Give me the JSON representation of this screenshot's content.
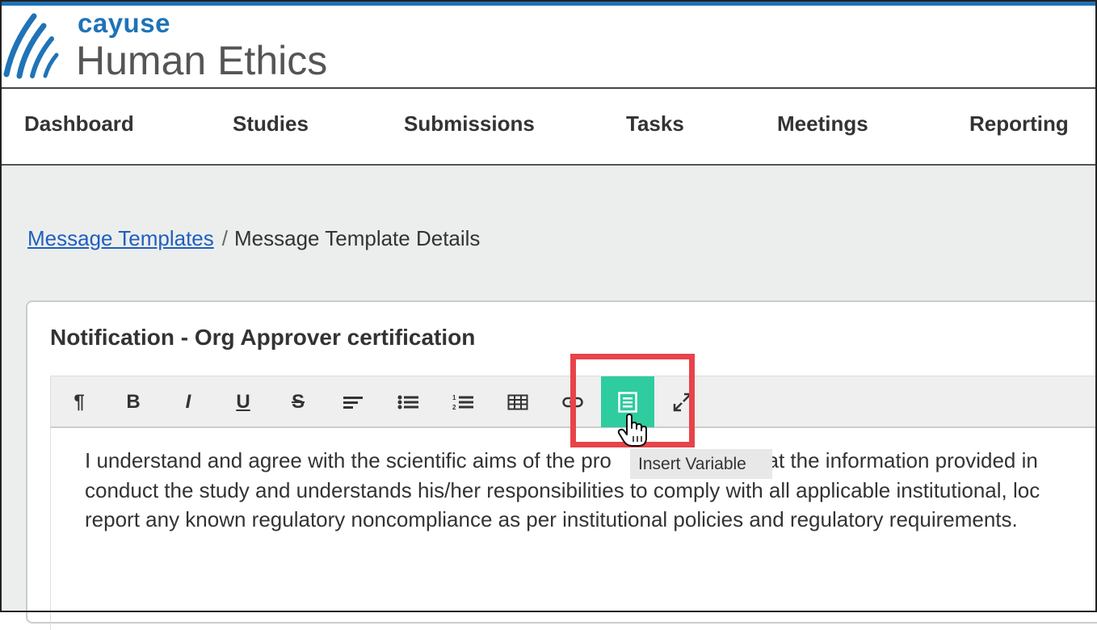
{
  "header": {
    "brand": "cayuse",
    "product": "Human Ethics",
    "colors": {
      "accent": "#1f73b7",
      "active_button": "#2ecc9f",
      "highlight": "#e8434a"
    }
  },
  "nav": {
    "items": [
      "Dashboard",
      "Studies",
      "Submissions",
      "Tasks",
      "Meetings",
      "Reporting"
    ]
  },
  "breadcrumb": {
    "link": "Message Templates",
    "separator": "/",
    "current": "Message Template Details"
  },
  "card": {
    "title": "Notification - Org Approver certification"
  },
  "toolbar": {
    "buttons": [
      {
        "icon": "paragraph-icon",
        "glyph": "¶"
      },
      {
        "icon": "bold-icon",
        "glyph": "B"
      },
      {
        "icon": "italic-icon",
        "glyph": "I"
      },
      {
        "icon": "underline-icon",
        "glyph": "U"
      },
      {
        "icon": "strikethrough-icon",
        "glyph": "S"
      },
      {
        "icon": "align-left-icon"
      },
      {
        "icon": "bullet-list-icon"
      },
      {
        "icon": "numbered-list-icon"
      },
      {
        "icon": "table-icon"
      },
      {
        "icon": "link-icon"
      },
      {
        "icon": "insert-variable-icon",
        "active": true
      },
      {
        "icon": "fullscreen-icon"
      }
    ],
    "tooltip": "Insert Variable"
  },
  "editor": {
    "lines": [
      "I understand and agree with the scientific aims of the pro",
      "that the information provided in",
      "conduct the study and understands his/her responsibilities to comply with all applicable institutional, loc",
      "report any known regulatory noncompliance as per institutional policies and regulatory requirements."
    ]
  }
}
